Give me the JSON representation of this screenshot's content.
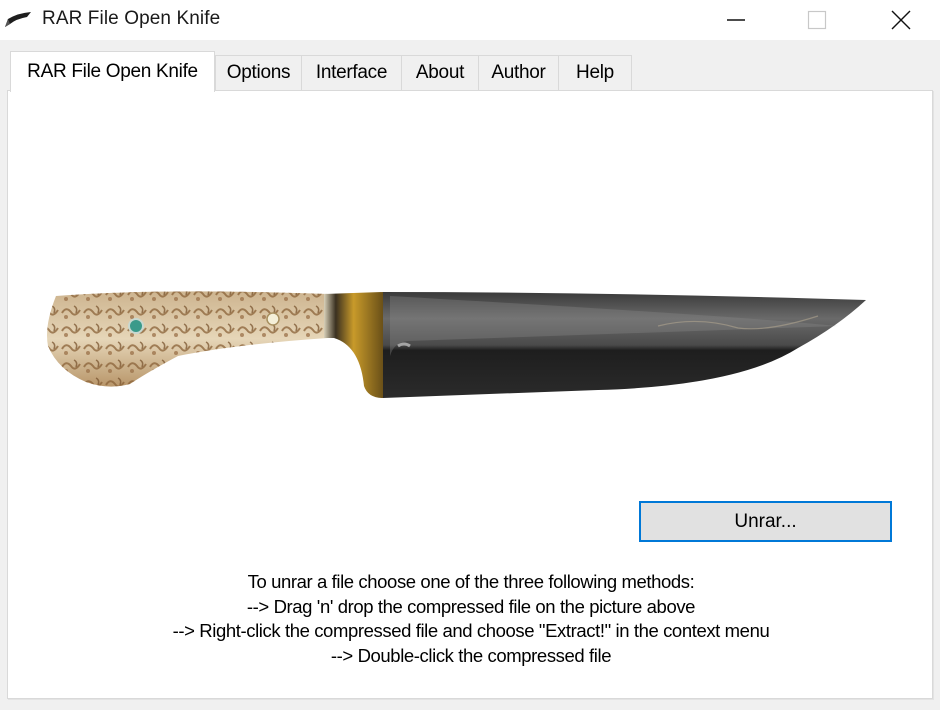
{
  "window": {
    "title": "RAR File Open Knife",
    "icon": "knife-icon",
    "controls": {
      "minimize": "minimize-icon",
      "maximize": "maximize-icon",
      "close": "close-icon"
    }
  },
  "tabs": [
    {
      "label": "RAR File Open Knife",
      "active": true
    },
    {
      "label": "Options",
      "active": false
    },
    {
      "label": "Interface",
      "active": false
    },
    {
      "label": "About",
      "active": false
    },
    {
      "label": "Author",
      "active": false
    },
    {
      "label": "Help",
      "active": false
    }
  ],
  "main": {
    "image": "knife-picture",
    "unrar_button": "Unrar...",
    "instructions": [
      "To unrar a file choose one of the three following methods:",
      "--> Drag 'n' drop the compressed file on the picture above",
      "--> Right-click the compressed file and choose \"Extract!\" in the context menu",
      "--> Double-click the compressed file"
    ]
  },
  "colors": {
    "accent": "#0078d7",
    "button_face": "#e1e1e1",
    "panel_bg": "#ffffff",
    "window_bg": "#f0f0f0"
  }
}
